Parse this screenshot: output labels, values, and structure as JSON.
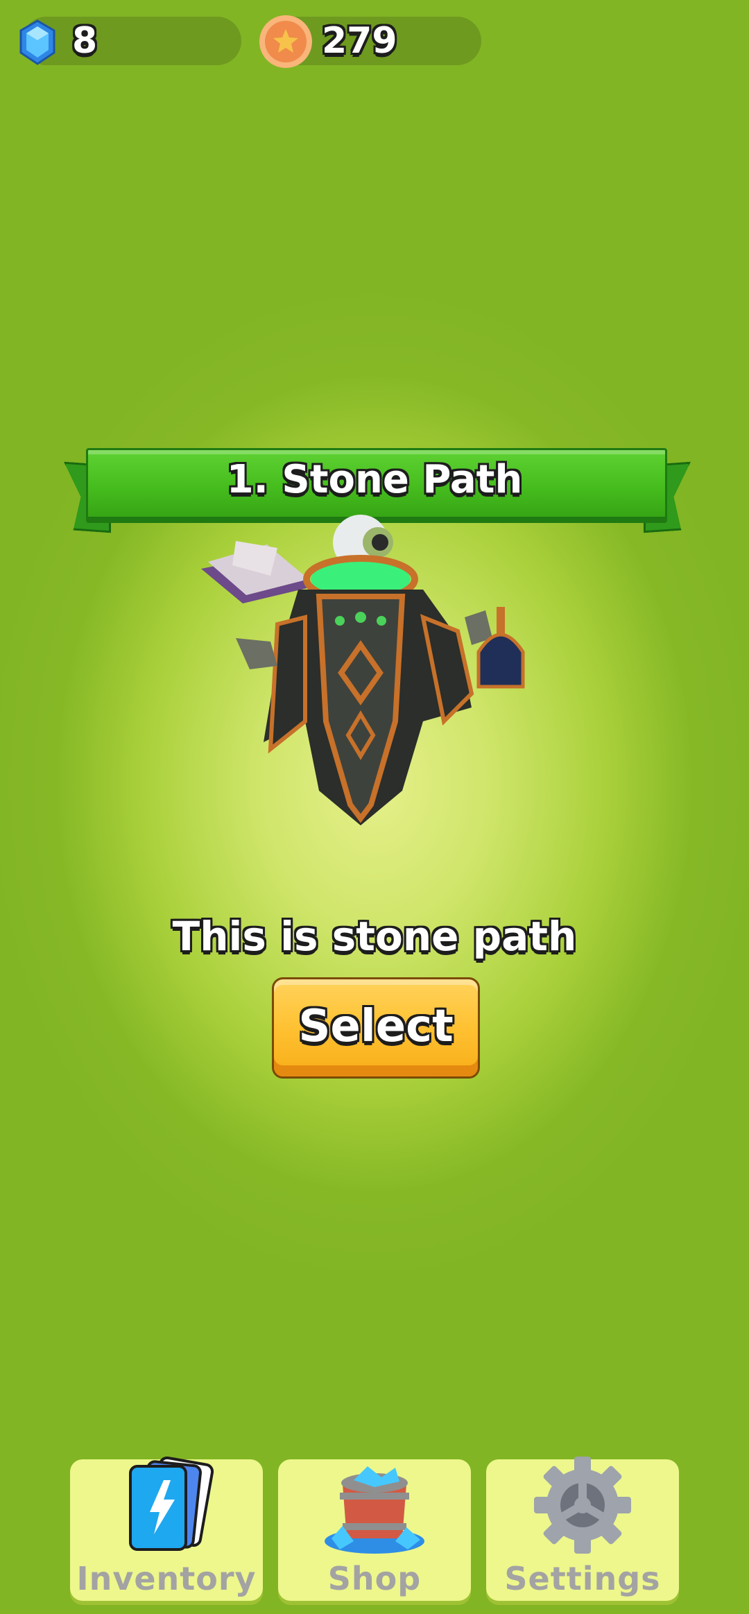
{
  "currency": {
    "gems": "8",
    "coins": "279",
    "gem_icon": "blue-gem-icon",
    "coin_icon": "star-coin-icon"
  },
  "banner": {
    "title": "1. Stone Path"
  },
  "character": {
    "icon": "wizard-character"
  },
  "description": "This is stone path",
  "select_button": {
    "label": "Select"
  },
  "nav": {
    "inventory": {
      "label": "Inventory",
      "icon": "cards-icon"
    },
    "shop": {
      "label": "Shop",
      "icon": "gem-barrel-icon"
    },
    "settings": {
      "label": "Settings",
      "icon": "gear-icon"
    }
  },
  "colors": {
    "background": "#82b524",
    "banner_green": "#46bd1e",
    "button_yellow": "#ffc132",
    "nav_button": "#edf78c"
  }
}
